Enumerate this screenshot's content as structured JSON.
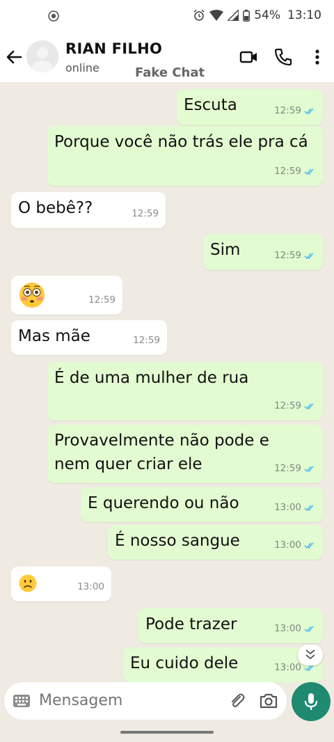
{
  "status_bar": {
    "battery": "54%",
    "time": "13:10"
  },
  "header": {
    "contact_name": "RIAN FILHO",
    "contact_status": "online",
    "watermark": "Fake Chat",
    "icons": [
      "back-arrow-icon",
      "video-call-icon",
      "phone-icon",
      "more-vert-icon"
    ]
  },
  "messages": [
    {
      "dir": "out",
      "text": "Escuta",
      "time": "12:59"
    },
    {
      "dir": "out",
      "text": "Porque você não trás ele pra cá",
      "time": "12:59"
    },
    {
      "dir": "in",
      "text": "O bebê??",
      "time": "12:59"
    },
    {
      "dir": "out",
      "text": "Sim",
      "time": "12:59"
    },
    {
      "dir": "in",
      "text": "😳",
      "time": "12:59"
    },
    {
      "dir": "in",
      "text": "Mas mãe",
      "time": "12:59"
    },
    {
      "dir": "out",
      "text": "É de uma mulher de rua",
      "time": "12:59"
    },
    {
      "dir": "out",
      "text": "Provavelmente não pode e nem quer criar ele",
      "time": "12:59"
    },
    {
      "dir": "out",
      "text": "E querendo ou não",
      "time": "13:00"
    },
    {
      "dir": "out",
      "text": "É nosso sangue",
      "time": "13:00"
    },
    {
      "dir": "in",
      "text": "☹️",
      "time": "13:00"
    },
    {
      "dir": "out",
      "text": "Pode trazer",
      "time": "13:00"
    },
    {
      "dir": "out",
      "text": "Eu cuido dele",
      "time": "13:00"
    }
  ],
  "input": {
    "placeholder": "Mensagem"
  },
  "colors": {
    "outgoing_bubble": "#e3fbd1",
    "incoming_bubble": "#ffffff",
    "chat_background": "#efeae2",
    "accent": "#1f8a70",
    "read_ticks": "#53bdeb"
  }
}
